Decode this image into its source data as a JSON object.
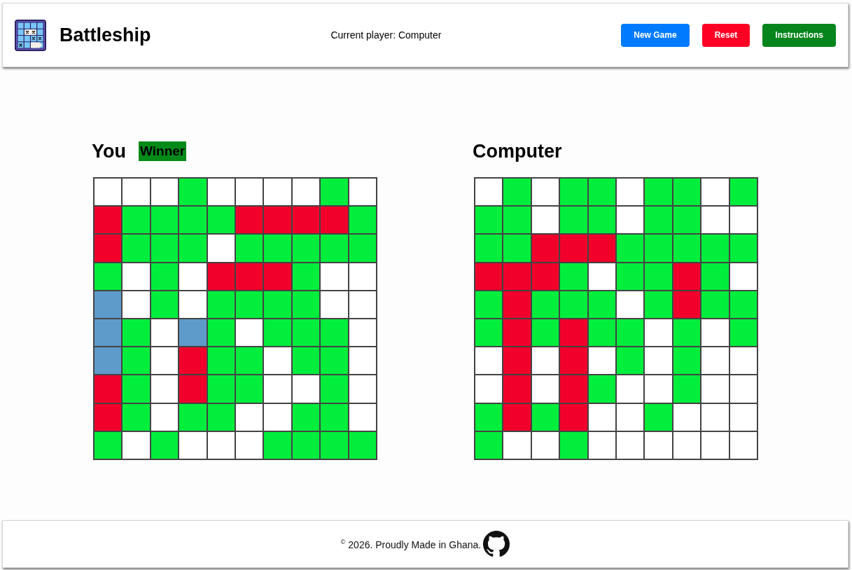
{
  "header": {
    "title": "Battleship",
    "status": "Current player: Computer",
    "buttons": [
      {
        "label": "New Game",
        "color": "#007bff"
      },
      {
        "label": "Reset",
        "color": "#ff0025"
      },
      {
        "label": "Instructions",
        "color": "#05851c"
      }
    ]
  },
  "boards": [
    {
      "title": "You",
      "badge": "Winner",
      "rows": [
        {
          "cells": [
            {
              "kind": "empty"
            },
            {
              "kind": "empty"
            },
            {
              "kind": "empty"
            },
            {
              "kind": "miss"
            },
            {
              "kind": "empty"
            },
            {
              "kind": "empty"
            },
            {
              "kind": "empty"
            },
            {
              "kind": "empty"
            },
            {
              "kind": "miss"
            },
            {
              "kind": "empty"
            }
          ]
        },
        {
          "cells": [
            {
              "kind": "hit"
            },
            {
              "kind": "miss"
            },
            {
              "kind": "miss"
            },
            {
              "kind": "miss"
            },
            {
              "kind": "miss"
            },
            {
              "kind": "hit"
            },
            {
              "kind": "hit"
            },
            {
              "kind": "hit"
            },
            {
              "kind": "hit"
            },
            {
              "kind": "miss"
            }
          ]
        },
        {
          "cells": [
            {
              "kind": "hit"
            },
            {
              "kind": "miss"
            },
            {
              "kind": "miss"
            },
            {
              "kind": "miss"
            },
            {
              "kind": "empty"
            },
            {
              "kind": "miss"
            },
            {
              "kind": "miss"
            },
            {
              "kind": "miss"
            },
            {
              "kind": "miss"
            },
            {
              "kind": "miss"
            }
          ]
        },
        {
          "cells": [
            {
              "kind": "miss"
            },
            {
              "kind": "empty"
            },
            {
              "kind": "miss"
            },
            {
              "kind": "empty"
            },
            {
              "kind": "hit"
            },
            {
              "kind": "hit"
            },
            {
              "kind": "hit"
            },
            {
              "kind": "miss"
            },
            {
              "kind": "empty"
            },
            {
              "kind": "empty"
            }
          ]
        },
        {
          "cells": [
            {
              "kind": "ship"
            },
            {
              "kind": "empty"
            },
            {
              "kind": "miss"
            },
            {
              "kind": "empty"
            },
            {
              "kind": "miss"
            },
            {
              "kind": "miss"
            },
            {
              "kind": "miss"
            },
            {
              "kind": "miss"
            },
            {
              "kind": "empty"
            },
            {
              "kind": "empty"
            }
          ]
        },
        {
          "cells": [
            {
              "kind": "ship"
            },
            {
              "kind": "miss"
            },
            {
              "kind": "empty"
            },
            {
              "kind": "ship"
            },
            {
              "kind": "miss"
            },
            {
              "kind": "empty"
            },
            {
              "kind": "miss"
            },
            {
              "kind": "miss"
            },
            {
              "kind": "miss"
            },
            {
              "kind": "empty"
            }
          ]
        },
        {
          "cells": [
            {
              "kind": "ship"
            },
            {
              "kind": "miss"
            },
            {
              "kind": "empty"
            },
            {
              "kind": "hit"
            },
            {
              "kind": "miss"
            },
            {
              "kind": "miss"
            },
            {
              "kind": "empty"
            },
            {
              "kind": "miss"
            },
            {
              "kind": "miss"
            },
            {
              "kind": "empty"
            }
          ]
        },
        {
          "cells": [
            {
              "kind": "hit"
            },
            {
              "kind": "miss"
            },
            {
              "kind": "empty"
            },
            {
              "kind": "hit"
            },
            {
              "kind": "miss"
            },
            {
              "kind": "miss"
            },
            {
              "kind": "empty"
            },
            {
              "kind": "empty"
            },
            {
              "kind": "miss"
            },
            {
              "kind": "empty"
            }
          ]
        },
        {
          "cells": [
            {
              "kind": "hit"
            },
            {
              "kind": "miss"
            },
            {
              "kind": "empty"
            },
            {
              "kind": "miss"
            },
            {
              "kind": "miss"
            },
            {
              "kind": "empty"
            },
            {
              "kind": "empty"
            },
            {
              "kind": "miss"
            },
            {
              "kind": "miss"
            },
            {
              "kind": "empty"
            }
          ]
        },
        {
          "cells": [
            {
              "kind": "miss"
            },
            {
              "kind": "empty"
            },
            {
              "kind": "miss"
            },
            {
              "kind": "empty"
            },
            {
              "kind": "empty"
            },
            {
              "kind": "empty"
            },
            {
              "kind": "miss"
            },
            {
              "kind": "miss"
            },
            {
              "kind": "miss"
            },
            {
              "kind": "miss"
            }
          ]
        }
      ]
    },
    {
      "title": "Computer",
      "rows": [
        {
          "cells": [
            {
              "kind": "empty"
            },
            {
              "kind": "miss"
            },
            {
              "kind": "empty"
            },
            {
              "kind": "miss"
            },
            {
              "kind": "miss"
            },
            {
              "kind": "empty"
            },
            {
              "kind": "miss"
            },
            {
              "kind": "miss"
            },
            {
              "kind": "empty"
            },
            {
              "kind": "miss"
            }
          ]
        },
        {
          "cells": [
            {
              "kind": "miss"
            },
            {
              "kind": "miss"
            },
            {
              "kind": "empty"
            },
            {
              "kind": "miss"
            },
            {
              "kind": "miss"
            },
            {
              "kind": "empty"
            },
            {
              "kind": "miss"
            },
            {
              "kind": "miss"
            },
            {
              "kind": "empty"
            },
            {
              "kind": "empty"
            }
          ]
        },
        {
          "cells": [
            {
              "kind": "miss"
            },
            {
              "kind": "miss"
            },
            {
              "kind": "hit"
            },
            {
              "kind": "hit"
            },
            {
              "kind": "hit"
            },
            {
              "kind": "miss"
            },
            {
              "kind": "miss"
            },
            {
              "kind": "miss"
            },
            {
              "kind": "miss"
            },
            {
              "kind": "miss"
            }
          ]
        },
        {
          "cells": [
            {
              "kind": "hit"
            },
            {
              "kind": "hit"
            },
            {
              "kind": "hit"
            },
            {
              "kind": "miss"
            },
            {
              "kind": "empty"
            },
            {
              "kind": "miss"
            },
            {
              "kind": "miss"
            },
            {
              "kind": "hit"
            },
            {
              "kind": "miss"
            },
            {
              "kind": "empty"
            }
          ]
        },
        {
          "cells": [
            {
              "kind": "miss"
            },
            {
              "kind": "hit"
            },
            {
              "kind": "miss"
            },
            {
              "kind": "miss"
            },
            {
              "kind": "miss"
            },
            {
              "kind": "empty"
            },
            {
              "kind": "miss"
            },
            {
              "kind": "hit"
            },
            {
              "kind": "miss"
            },
            {
              "kind": "miss"
            }
          ]
        },
        {
          "cells": [
            {
              "kind": "miss"
            },
            {
              "kind": "hit"
            },
            {
              "kind": "miss"
            },
            {
              "kind": "hit"
            },
            {
              "kind": "miss"
            },
            {
              "kind": "miss"
            },
            {
              "kind": "empty"
            },
            {
              "kind": "miss"
            },
            {
              "kind": "empty"
            },
            {
              "kind": "miss"
            }
          ]
        },
        {
          "cells": [
            {
              "kind": "empty"
            },
            {
              "kind": "hit"
            },
            {
              "kind": "empty"
            },
            {
              "kind": "hit"
            },
            {
              "kind": "empty"
            },
            {
              "kind": "miss"
            },
            {
              "kind": "empty"
            },
            {
              "kind": "miss"
            },
            {
              "kind": "empty"
            },
            {
              "kind": "empty"
            }
          ]
        },
        {
          "cells": [
            {
              "kind": "empty"
            },
            {
              "kind": "hit"
            },
            {
              "kind": "empty"
            },
            {
              "kind": "hit"
            },
            {
              "kind": "miss"
            },
            {
              "kind": "empty"
            },
            {
              "kind": "empty"
            },
            {
              "kind": "miss"
            },
            {
              "kind": "empty"
            },
            {
              "kind": "empty"
            }
          ]
        },
        {
          "cells": [
            {
              "kind": "miss"
            },
            {
              "kind": "hit"
            },
            {
              "kind": "miss"
            },
            {
              "kind": "hit"
            },
            {
              "kind": "empty"
            },
            {
              "kind": "empty"
            },
            {
              "kind": "miss"
            },
            {
              "kind": "empty"
            },
            {
              "kind": "empty"
            },
            {
              "kind": "empty"
            }
          ]
        },
        {
          "cells": [
            {
              "kind": "miss"
            },
            {
              "kind": "empty"
            },
            {
              "kind": "empty"
            },
            {
              "kind": "miss"
            },
            {
              "kind": "empty"
            },
            {
              "kind": "empty"
            },
            {
              "kind": "empty"
            },
            {
              "kind": "empty"
            },
            {
              "kind": "empty"
            },
            {
              "kind": "empty"
            }
          ]
        }
      ]
    }
  ],
  "footer": {
    "text": "$^{©}$ 2026. Proudly Made in Ghana."
  }
}
